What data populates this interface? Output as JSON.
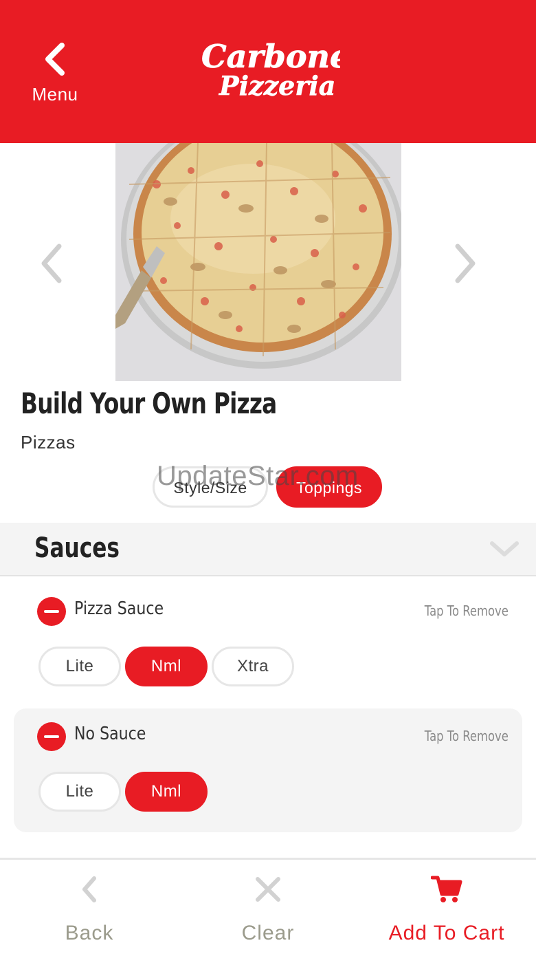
{
  "header": {
    "back_label": "Menu",
    "logo_line1": "Carbone's",
    "logo_line2": "Pizzeria",
    "brand_color": "#e81c24"
  },
  "hero": {
    "image_alt": "Pizza photo",
    "prev_icon": "chevron-left-icon",
    "next_icon": "chevron-right-icon"
  },
  "item": {
    "title": "Build Your Own Pizza",
    "category": "Pizzas"
  },
  "tabs": {
    "style_size": "Style/Size",
    "toppings": "Toppings",
    "active": "Toppings"
  },
  "watermark": "UpdateStar.com",
  "section": {
    "title": "Sauces",
    "chevron_icon": "chevron-down-icon"
  },
  "options": [
    {
      "name": "Pizza Sauce",
      "action": "Tap To Remove",
      "amounts": [
        "Lite",
        "Nml",
        "Xtra"
      ],
      "selected": "Nml"
    },
    {
      "name": "No Sauce",
      "action": "Tap To Remove",
      "amounts": [
        "Lite",
        "Nml"
      ],
      "selected": "Nml"
    }
  ],
  "bottom_bar": {
    "back": "Back",
    "clear": "Clear",
    "add_to_cart": "Add To Cart",
    "inactive_color": "#9b9b8c",
    "accent_color": "#e81c24"
  }
}
